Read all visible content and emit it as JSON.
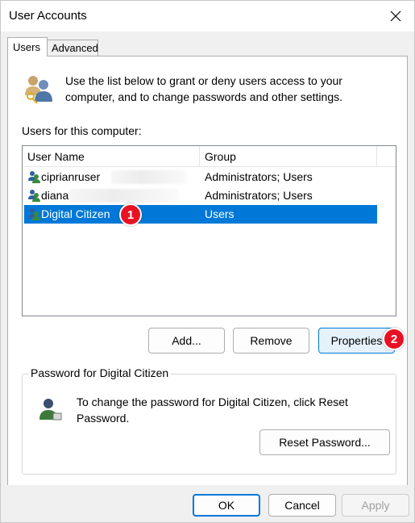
{
  "window": {
    "title": "User Accounts"
  },
  "tabs": [
    {
      "label": "Users"
    },
    {
      "label": "Advanced"
    }
  ],
  "intro_text": "Use the list below to grant or deny users access to your computer, and to change passwords and other settings.",
  "users_label": "Users for this computer:",
  "list": {
    "columns": [
      "User Name",
      "Group"
    ],
    "rows": [
      {
        "name": "ciprianruser",
        "group": "Administrators; Users"
      },
      {
        "name": "diana",
        "group": "Administrators; Users"
      },
      {
        "name": "Digital Citizen",
        "group": "Users"
      }
    ]
  },
  "buttons": {
    "add": "Add...",
    "remove": "Remove",
    "properties": "Properties",
    "reset_password": "Reset Password...",
    "ok": "OK",
    "cancel": "Cancel",
    "apply": "Apply"
  },
  "password_group": {
    "title": "Password for Digital Citizen",
    "text": "To change the password for Digital Citizen, click Reset Password."
  },
  "badges": [
    "1",
    "2"
  ],
  "colors": {
    "selection": "#0078d7",
    "badge": "#e81123"
  }
}
